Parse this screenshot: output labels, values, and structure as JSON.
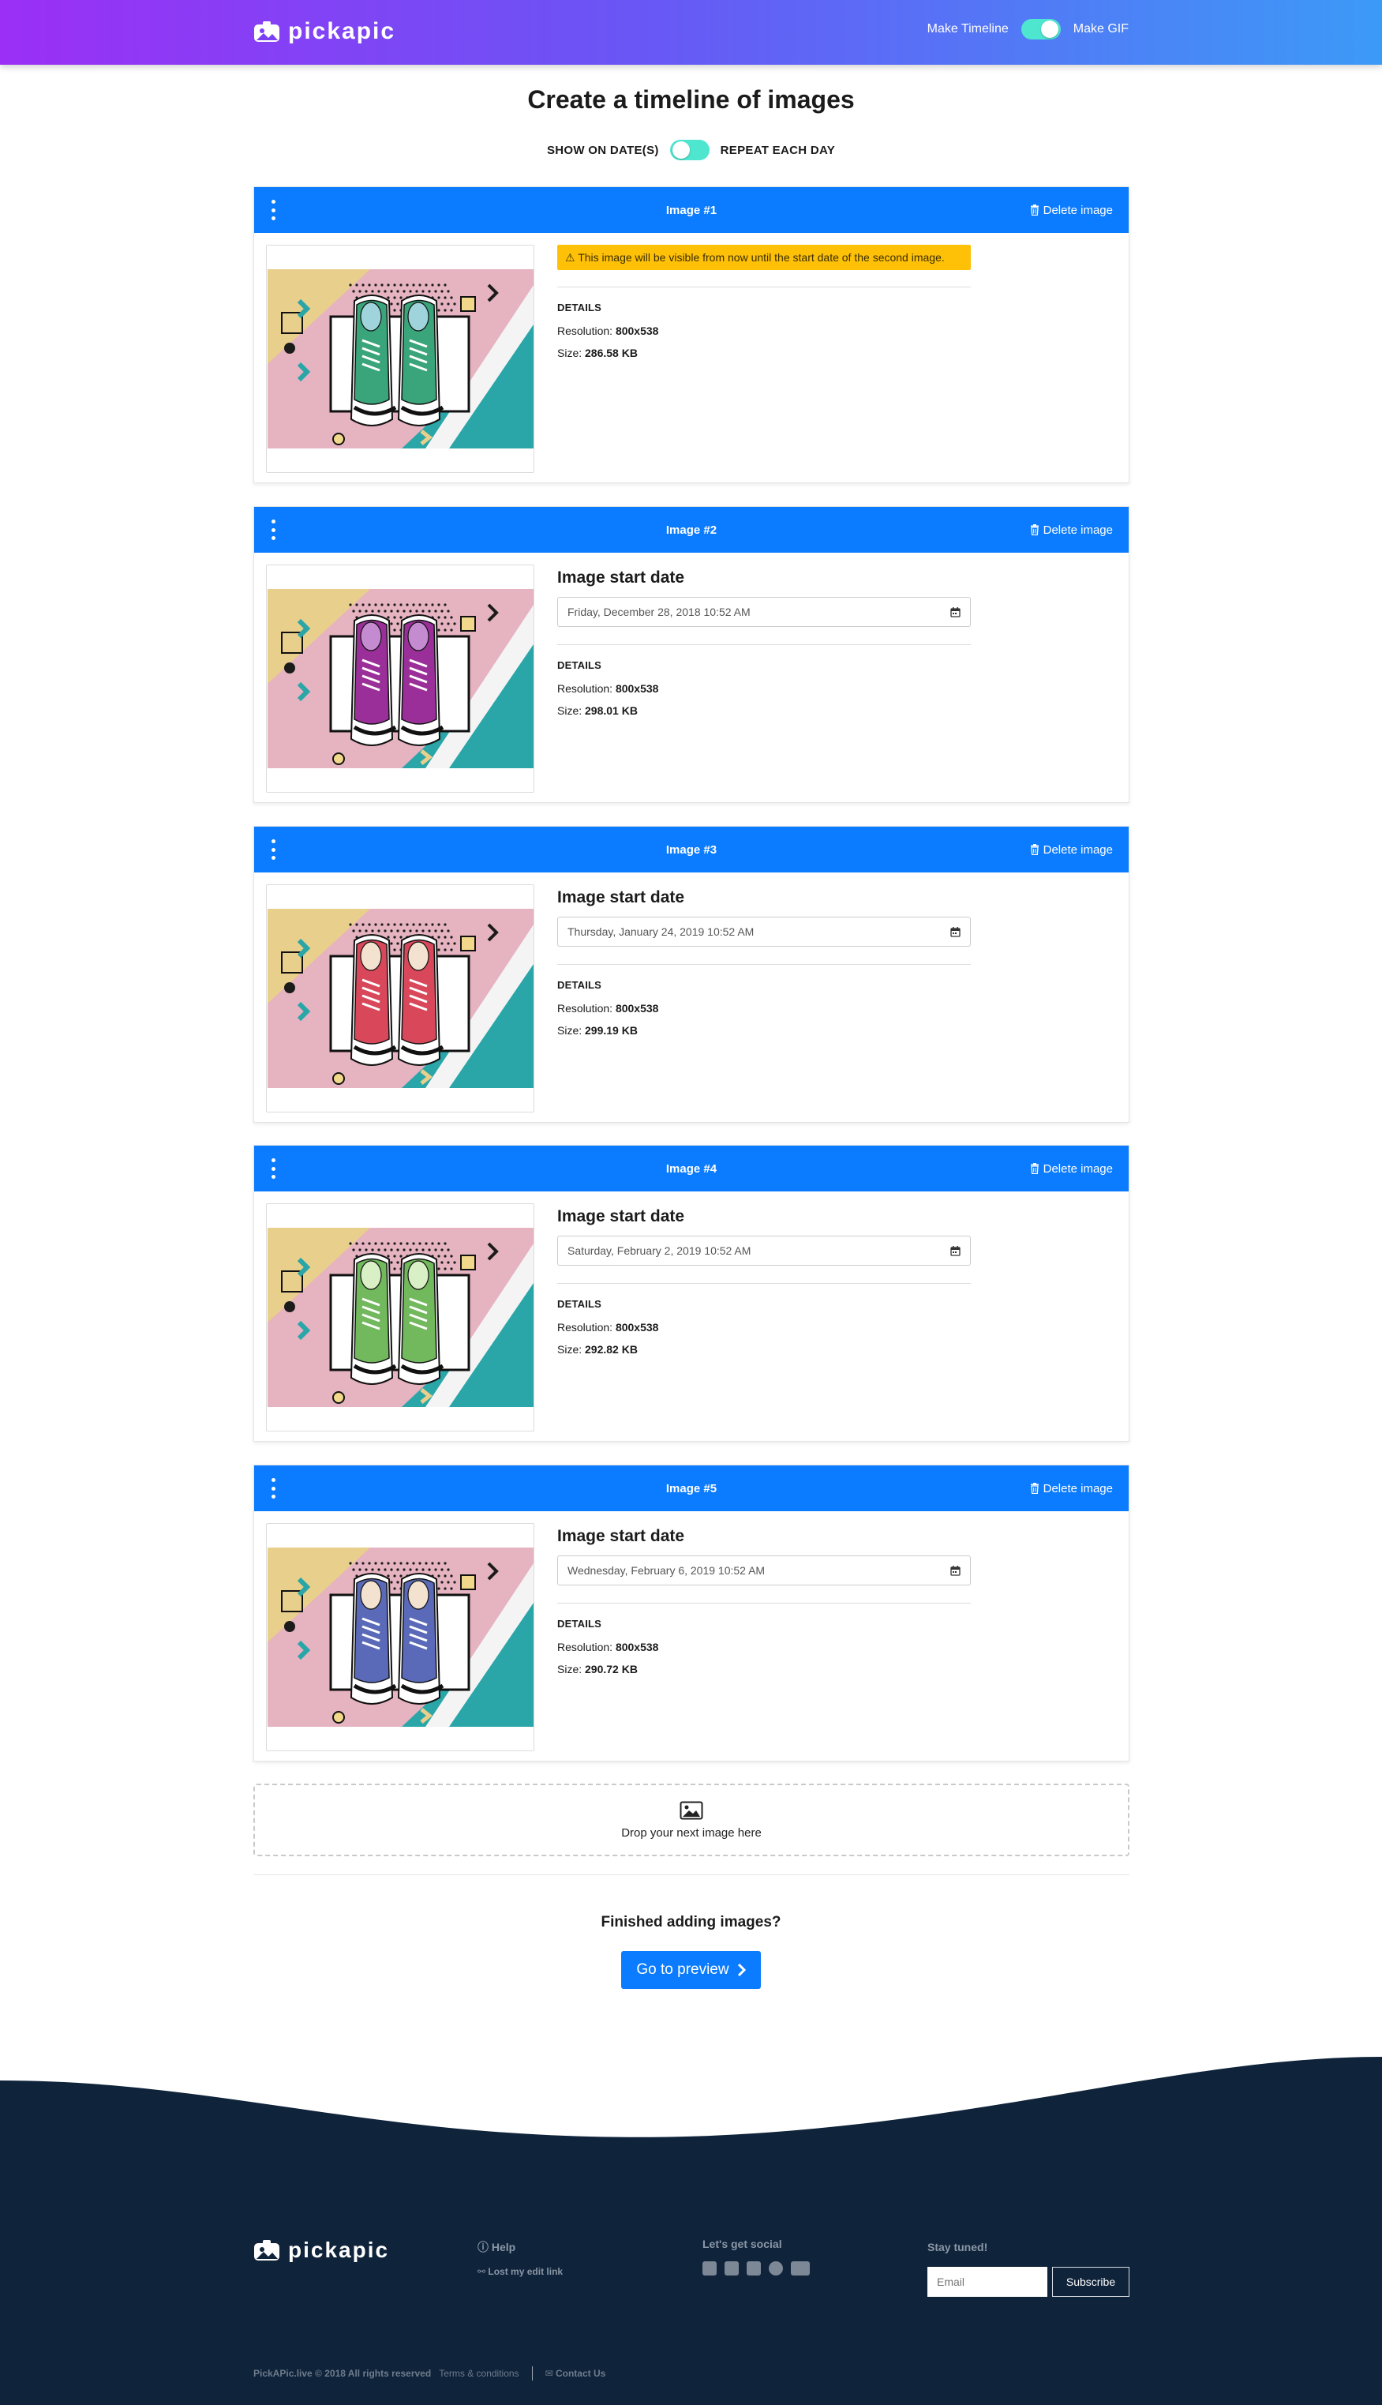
{
  "header": {
    "brand": "pickapic",
    "mode_left": "Make Timeline",
    "mode_right": "Make GIF"
  },
  "main": {
    "title": "Create a timeline of images",
    "date_mode_left": "SHOW ON DATE(S)",
    "date_mode_right": "REPEAT EACH DAY",
    "delete_label": "Delete image",
    "start_date_label": "Image start date",
    "details_heading": "DETAILS",
    "resolution_label": "Resolution:",
    "size_label": "Size:",
    "images": [
      {
        "title": "Image #1",
        "warning": "This image will be visible from now until the start date of the second image.",
        "date": "",
        "resolution": "800x538",
        "size": "286.58 KB",
        "shoe_color": "#3aa57a",
        "lace_color": "#9fd4dd"
      },
      {
        "title": "Image #2",
        "warning": "",
        "date": "Friday, December 28, 2018 10:52 AM",
        "resolution": "800x538",
        "size": "298.01 KB",
        "shoe_color": "#9b2f99",
        "lace_color": "#c58bd0"
      },
      {
        "title": "Image #3",
        "warning": "",
        "date": "Thursday, January 24, 2019 10:52 AM",
        "resolution": "800x538",
        "size": "299.19 KB",
        "shoe_color": "#d8485a",
        "lace_color": "#f2e2cf"
      },
      {
        "title": "Image #4",
        "warning": "",
        "date": "Saturday, February 2, 2019 10:52 AM",
        "resolution": "800x538",
        "size": "292.82 KB",
        "shoe_color": "#72b85c",
        "lace_color": "#d9efc5"
      },
      {
        "title": "Image #5",
        "warning": "",
        "date": "Wednesday, February 6, 2019 10:52 AM",
        "resolution": "800x538",
        "size": "290.72 KB",
        "shoe_color": "#5a6ab9",
        "lace_color": "#f2e2cf"
      }
    ],
    "dropzone_text": "Drop your next image here",
    "finished_text": "Finished adding images?",
    "preview_button": "Go to preview"
  },
  "footer": {
    "brand": "pickapic",
    "help": "Help",
    "lost_link": "Lost my edit link",
    "social_heading": "Let's get social",
    "social_icons": [
      "facebook-icon",
      "twitter-icon",
      "linkedin-icon",
      "instagram-icon",
      "youtube-icon"
    ],
    "stay_tuned": "Stay tuned!",
    "email_placeholder": "Email",
    "subscribe": "Subscribe",
    "copyright": "PickAPic.live © 2018 All rights reserved",
    "terms": "Terms & conditions",
    "contact": "Contact Us"
  },
  "colors": {
    "primary": "#0b7bff",
    "warning": "#ffc107",
    "footer_bg": "#0f233a",
    "toggle": "#4fe6cf"
  }
}
